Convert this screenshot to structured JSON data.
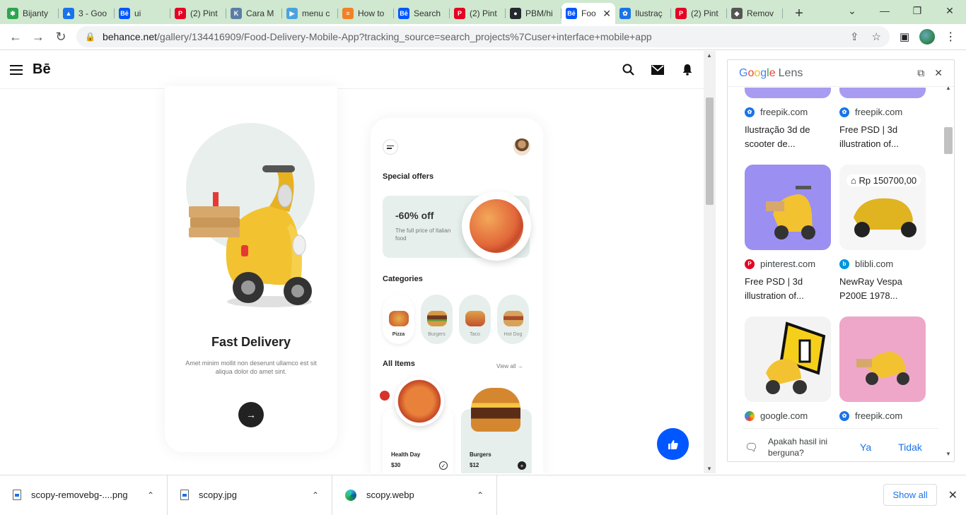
{
  "browser": {
    "tabs": [
      {
        "title": "Bijanty",
        "favicon_color": "#2da44e",
        "glyph": "✱"
      },
      {
        "title": "3 - Goo",
        "favicon_color": "#1a73e8",
        "glyph": "▲"
      },
      {
        "title": "ui",
        "favicon_color": "#0057ff",
        "glyph": "Bē"
      },
      {
        "title": "(2) Pint",
        "favicon_color": "#e60023",
        "glyph": "P"
      },
      {
        "title": "Cara M",
        "favicon_color": "#5b7ea6",
        "glyph": "K"
      },
      {
        "title": "menu c",
        "favicon_color": "#4aa3df",
        "glyph": "▶"
      },
      {
        "title": "How to",
        "favicon_color": "#f48024",
        "glyph": "≡"
      },
      {
        "title": "Search",
        "favicon_color": "#0057ff",
        "glyph": "Bē"
      },
      {
        "title": "(2) Pint",
        "favicon_color": "#e60023",
        "glyph": "P"
      },
      {
        "title": "PBM/hi",
        "favicon_color": "#24292f",
        "glyph": "●"
      },
      {
        "title": "Foo",
        "favicon_color": "#0057ff",
        "glyph": "Bē",
        "active": true
      },
      {
        "title": "Ilustraç",
        "favicon_color": "#1a73e8",
        "glyph": "✿"
      },
      {
        "title": "(2) Pint",
        "favicon_color": "#e60023",
        "glyph": "P"
      },
      {
        "title": "Remov",
        "favicon_color": "#555555",
        "glyph": "◆"
      }
    ],
    "url_host": "behance.net",
    "url_path": "/gallery/134416909/Food-Delivery-Mobile-App?tracking_source=search_projects%7Cuser+interface+mobile+app"
  },
  "behance": {
    "logo": "Bē"
  },
  "mockup1": {
    "title": "Fast Delivery",
    "description": "Amet minim mollit non deserunt ullamco est sit aliqua dolor do amet sint."
  },
  "mockup2": {
    "special_offers": "Special offers",
    "offer_pct": "-60% off",
    "offer_sub": "The full price of Italian food",
    "categories_title": "Categories",
    "categories": [
      "Pizza",
      "Burgers",
      "Taco",
      "Hot Dog"
    ],
    "all_items_title": "All Items",
    "view_all": "View all",
    "items": [
      {
        "name": "Health Day",
        "price": "$30"
      },
      {
        "name": "Burgers",
        "price": "$12"
      }
    ]
  },
  "lens": {
    "brand": "Google",
    "brand_suffix": "Lens",
    "results": [
      {
        "source": "freepik.com",
        "title": "Ilustração 3d de scooter de...",
        "icon_color": "#1a73e8"
      },
      {
        "source": "freepik.com",
        "title": "Free PSD | 3d illustration of...",
        "icon_color": "#1a73e8"
      },
      {
        "source": "pinterest.com",
        "title": "Free PSD | 3d illustration of...",
        "icon_color": "#e60023"
      },
      {
        "source": "blibli.com",
        "title": "NewRay Vespa P200E 1978...",
        "icon_color": "#0095da",
        "price": "Rp 150700,00"
      },
      {
        "source": "google.com",
        "title": "",
        "icon_color": "#34a853"
      },
      {
        "source": "freepik.com",
        "title": "",
        "icon_color": "#1a73e8"
      }
    ],
    "feedback_question": "Apakah hasil ini berguna?",
    "feedback_yes": "Ya",
    "feedback_no": "Tidak"
  },
  "downloads": {
    "files": [
      "scopy-removebg-....png",
      "scopy.jpg",
      "scopy.webp"
    ],
    "show_all": "Show all"
  },
  "colors": {
    "behance_blue": "#0057ff",
    "tabstrip": "#cfe8cf",
    "mint": "#e6efec",
    "link_blue": "#1a73e8"
  }
}
